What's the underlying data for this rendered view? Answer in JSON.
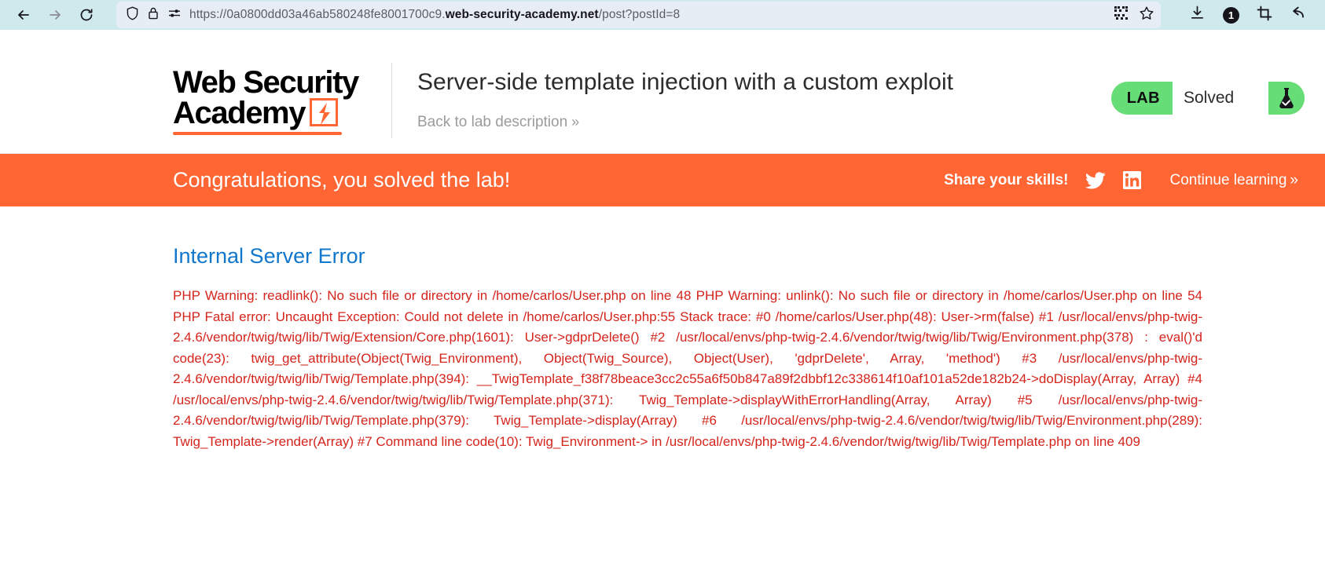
{
  "browser": {
    "back_icon": "arrow-left-icon",
    "forward_icon": "arrow-right-icon",
    "reload_icon": "reload-icon",
    "shield_icon": "shield-icon",
    "lock_icon": "padlock-icon",
    "permissions_icon": "site-permissions-icon",
    "url_prefix": "https://0a0800dd03a46ab580248fe8001700c9.",
    "url_host": "web-security-academy.net",
    "url_path": "/post?postId=8",
    "qr_icon": "qr-code-icon",
    "bookmark_icon": "star-icon",
    "download_icon": "download-icon",
    "notification_count": "1",
    "screenshot_icon": "crop-icon",
    "undo_icon": "undo-arrow-icon"
  },
  "header": {
    "logo_line1": "Web Security",
    "logo_line2": "Academy",
    "logo_bolt_icon": "lightning-bolt-icon",
    "lab_title": "Server-side template injection with a custom exploit",
    "back_link": "Back to lab description",
    "back_link_chevron": "»",
    "lab_tag": "LAB",
    "lab_status": "Solved",
    "lab_flask_icon": "flask-check-icon",
    "lab_status_color": "#66dd77"
  },
  "banner": {
    "congrats": "Congratulations, you solved the lab!",
    "share_label": "Share your skills!",
    "twitter_icon": "twitter-bird-icon",
    "linkedin_icon": "linkedin-icon",
    "continue_label": "Continue learning",
    "continue_chevron": "»",
    "background_color": "#ff6633"
  },
  "main": {
    "error_heading": "Internal Server Error",
    "error_color": "#d4241c",
    "error_text": " PHP Warning: readlink(): No such file or directory in /home/carlos/User.php on line 48 PHP Warning: unlink(): No such file or directory in /home/carlos/User.php on line 54 PHP Fatal error: Uncaught Exception: Could not delete in /home/carlos/User.php:55 Stack trace: #0 /home/carlos/User.php(48): User->rm(false) #1 /usr/local/envs/php-twig-2.4.6/vendor/twig/twig/lib/Twig/Extension/Core.php(1601): User->gdprDelete() #2 /usr/local/envs/php-twig-2.4.6/vendor/twig/twig/lib/Twig/Environment.php(378) : eval()'d code(23): twig_get_attribute(Object(Twig_Environment), Object(Twig_Source), Object(User), 'gdprDelete', Array, 'method') #3 /usr/local/envs/php-twig-2.4.6/vendor/twig/twig/lib/Twig/Template.php(394): __TwigTemplate_f38f78beace3cc2c55a6f50b847a89f2dbbf12c338614f10af101a52de182b24->doDisplay(Array, Array) #4 /usr/local/envs/php-twig-2.4.6/vendor/twig/twig/lib/Twig/Template.php(371): Twig_Template->displayWithErrorHandling(Array, Array) #5 /usr/local/envs/php-twig-2.4.6/vendor/twig/twig/lib/Twig/Template.php(379): Twig_Template->display(Array) #6 /usr/local/envs/php-twig-2.4.6/vendor/twig/twig/lib/Twig/Environment.php(289): Twig_Template->render(Array) #7 Command line code(10): Twig_Environment-> in /usr/local/envs/php-twig-2.4.6/vendor/twig/twig/lib/Twig/Template.php on line 409"
  }
}
